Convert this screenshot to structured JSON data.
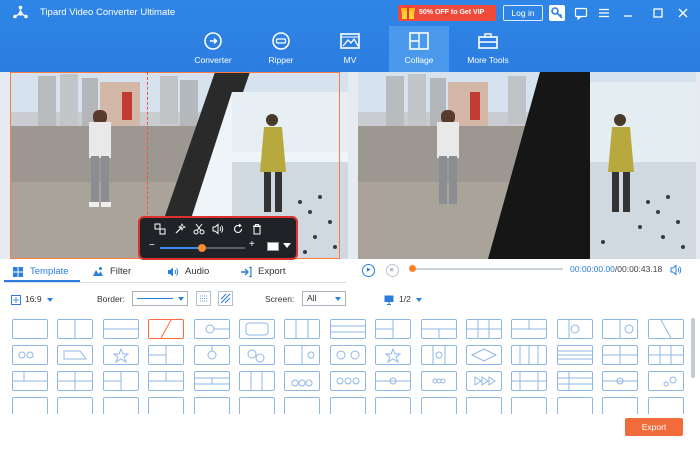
{
  "app": {
    "title": "Tipard Video Converter Ultimate",
    "vip_promo": "50% OFF to Get VIP",
    "login_label": "Log in"
  },
  "nav": {
    "items": [
      {
        "label": "Converter",
        "icon": "converter-icon"
      },
      {
        "label": "Ripper",
        "icon": "ripper-icon"
      },
      {
        "label": "MV",
        "icon": "mv-icon"
      },
      {
        "label": "Collage",
        "icon": "collage-icon"
      },
      {
        "label": "More Tools",
        "icon": "toolbox-icon"
      }
    ],
    "active": "Collage"
  },
  "tabs": [
    {
      "label": "Template",
      "icon": "template-icon"
    },
    {
      "label": "Filter",
      "icon": "filter-icon"
    },
    {
      "label": "Audio",
      "icon": "audio-icon"
    },
    {
      "label": "Export",
      "icon": "export-icon"
    }
  ],
  "active_tab": "Template",
  "edit_toolbar": {
    "icons": [
      "swap-icon",
      "magic-wand-icon",
      "scissors-icon",
      "volume-icon",
      "rotate-icon",
      "trash-icon"
    ],
    "zoom_level": 0.5
  },
  "player": {
    "current_time": "00:00:00.00",
    "total_time": "/00:00:43.18",
    "progress": 0.0
  },
  "options": {
    "aspect_ratio": "16:9",
    "border_label": "Border:",
    "screen_label": "Screen:",
    "screen_value": "All",
    "page": "1/2"
  },
  "templates": {
    "selected_index": 3,
    "rows": 4,
    "per_row": 15
  },
  "footer": {
    "export_label": "Export"
  },
  "colors": {
    "brand_blue": "#2c7de0",
    "accent_orange": "#f26b3a",
    "vip_red": "#f04b3a",
    "highlight_red": "#e03030"
  }
}
